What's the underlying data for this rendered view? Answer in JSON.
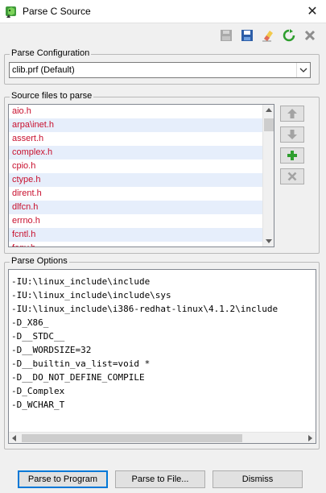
{
  "window": {
    "title": "Parse C Source",
    "close_glyph": "✕"
  },
  "toolbar": {
    "icons": [
      "disk-gray-icon",
      "save-icon",
      "eraser-icon",
      "refresh-icon",
      "delete-icon"
    ]
  },
  "parse_config": {
    "group_label": "Parse Configuration",
    "selected": "clib.prf (Default)"
  },
  "source_files": {
    "group_label": "Source files to parse",
    "files": [
      "aio.h",
      "arpa\\inet.h",
      "assert.h",
      "complex.h",
      "cpio.h",
      "ctype.h",
      "dirent.h",
      "dlfcn.h",
      "errno.h",
      "fcntl.h",
      "fenv.h"
    ]
  },
  "parse_options": {
    "group_label": "Parse Options",
    "lines": [
      "-IU:\\linux_include\\include",
      "-IU:\\linux_include\\include\\sys",
      "-IU:\\linux_include\\i386-redhat-linux\\4.1.2\\include",
      "-D_X86_",
      "-D__STDC__",
      "-D__WORDSIZE=32",
      "-D__builtin_va_list=void *",
      "-D__DO_NOT_DEFINE_COMPILE",
      "-D_Complex",
      "-D_WCHAR_T"
    ]
  },
  "buttons": {
    "parse_program": "Parse to Program",
    "parse_file": "Parse to File...",
    "dismiss": "Dismiss"
  },
  "colors": {
    "file_text": "#c8102e",
    "alt_row": "#e6eefb",
    "accent": "#0078d7"
  }
}
